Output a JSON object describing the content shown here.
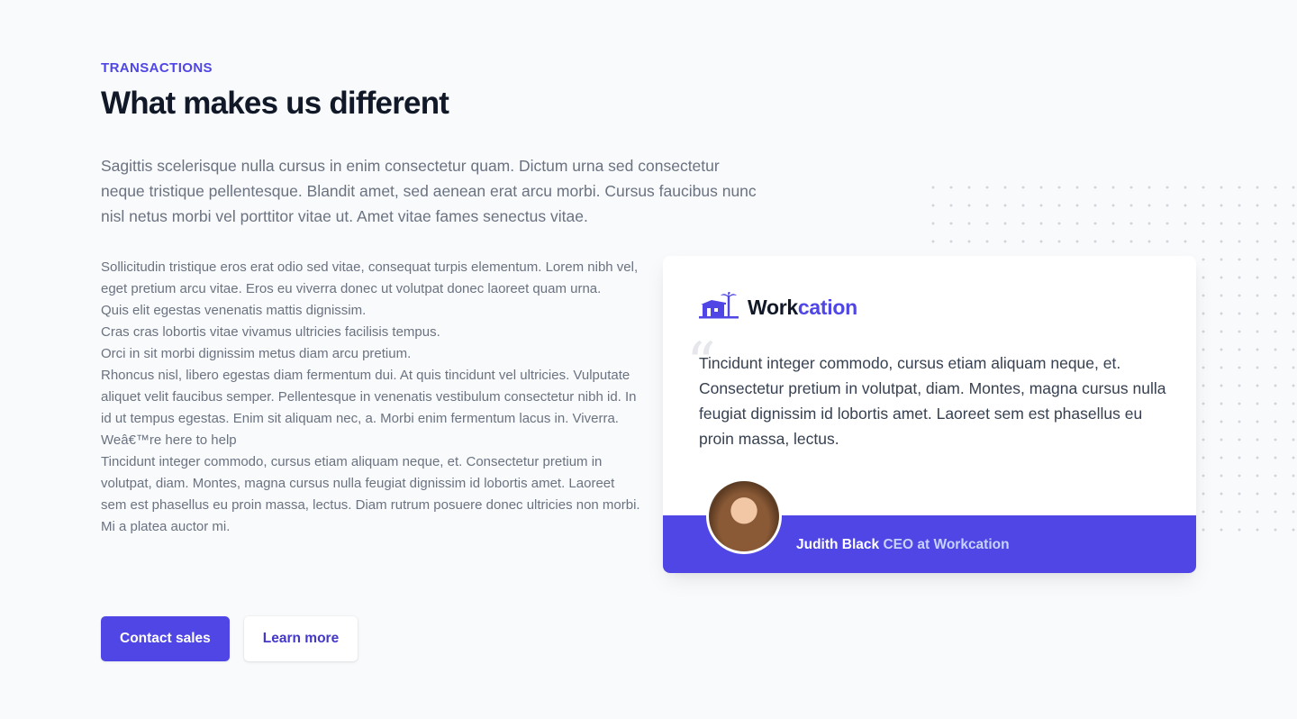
{
  "section": {
    "eyebrow": "TRANSACTIONS",
    "title": "What makes us different",
    "lead": "Sagittis scelerisque nulla cursus in enim consectetur quam. Dictum urna sed consectetur neque tristique pellentesque. Blandit amet, sed aenean erat arcu morbi. Cursus faucibus nunc nisl netus morbi vel porttitor vitae ut. Amet vitae fames senectus vitae.",
    "body": [
      "Sollicitudin tristique eros erat odio sed vitae, consequat turpis elementum. Lorem nibh vel, eget pretium arcu vitae. Eros eu viverra donec ut volutpat donec laoreet quam urna.",
      "Quis elit egestas venenatis mattis dignissim.",
      "Cras cras lobortis vitae vivamus ultricies facilisis tempus.",
      "Orci in sit morbi dignissim metus diam arcu pretium.",
      "Rhoncus nisl, libero egestas diam fermentum dui. At quis tincidunt vel ultricies. Vulputate aliquet velit faucibus semper. Pellentesque in venenatis vestibulum consectetur nibh id. In id ut tempus egestas. Enim sit aliquam nec, a. Morbi enim fermentum lacus in. Viverra.",
      "Weâ€™re here to help",
      "Tincidunt integer commodo, cursus etiam aliquam neque, et. Consectetur pretium in volutpat, diam. Montes, magna cursus nulla feugiat dignissim id lobortis amet. Laoreet sem est phasellus eu proin massa, lectus. Diam rutrum posuere donec ultricies non morbi. Mi a platea auctor mi."
    ]
  },
  "actions": {
    "primary_label": "Contact sales",
    "secondary_label": "Learn more"
  },
  "testimonial": {
    "logo_word_1": "Work",
    "logo_word_2": "cation",
    "quote_mark": "“",
    "quote": "Tincidunt integer commodo, cursus etiam aliquam neque, et. Consectetur pretium in volutpat, diam. Montes, magna cursus nulla feugiat dignissim id lobortis amet. Laoreet sem est phasellus eu proin massa, lectus.",
    "author_name": "Judith Black",
    "author_role": "CEO at Workcation",
    "logo_icon": "house-palm-icon",
    "avatar": "avatar-photo"
  },
  "colors": {
    "accent": "#4f46e5",
    "background": "#f8fafc",
    "heading": "#111827",
    "muted_text": "#6b7280",
    "footer_role": "#c7d2fe"
  }
}
